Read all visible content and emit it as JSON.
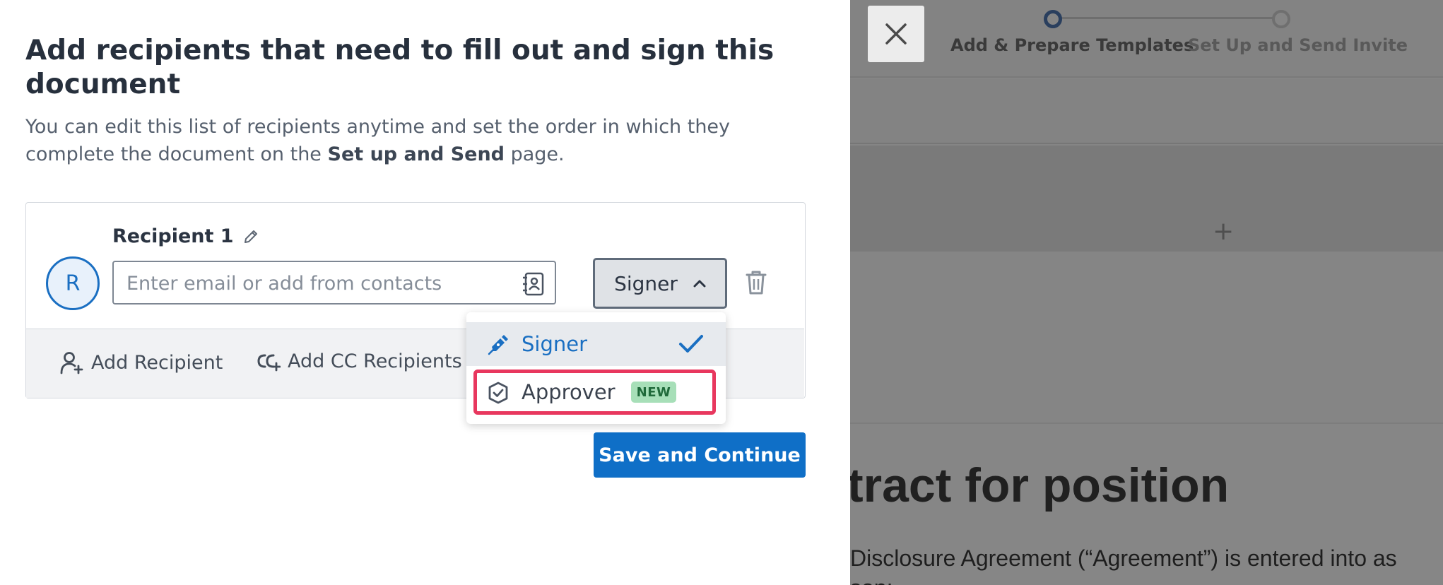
{
  "wizard": {
    "close_icon": "close-icon",
    "steps": [
      {
        "label": "Add & Prepare Templates",
        "state": "active"
      },
      {
        "label": "Set Up and Send Invite",
        "state": "upcoming"
      }
    ],
    "add_icon": "+"
  },
  "document_preview": {
    "heading": "tract for position",
    "body_line_1": "Disclosure Agreement (“Agreement”) is entered into as",
    "body_line_2": "son:"
  },
  "modal": {
    "title": "Add recipients that need to fill out and sign this document",
    "description_prefix": "You can edit this list of recipients anytime and set the order in which they complete the document on the ",
    "description_bold": "Set up and Send",
    "description_suffix": " page."
  },
  "recipient": {
    "avatar_initial": "R",
    "label": "Recipient 1",
    "email_value": "",
    "email_placeholder": "Enter email or add from contacts",
    "role_selected": "Signer"
  },
  "footer_actions": {
    "add_recipient": "Add Recipient",
    "add_cc": "Add CC Recipients"
  },
  "role_menu": {
    "options": [
      {
        "label": "Signer",
        "icon": "pen-icon",
        "selected": true
      },
      {
        "label": "Approver",
        "icon": "badge-check-icon",
        "badge": "NEW",
        "highlighted": true
      }
    ]
  },
  "save_button": "Save and Continue",
  "colors": {
    "accent": "#0f6fc7",
    "highlight": "#e8375e",
    "new_badge": "#a7dfb8",
    "overlay": "#858585"
  }
}
